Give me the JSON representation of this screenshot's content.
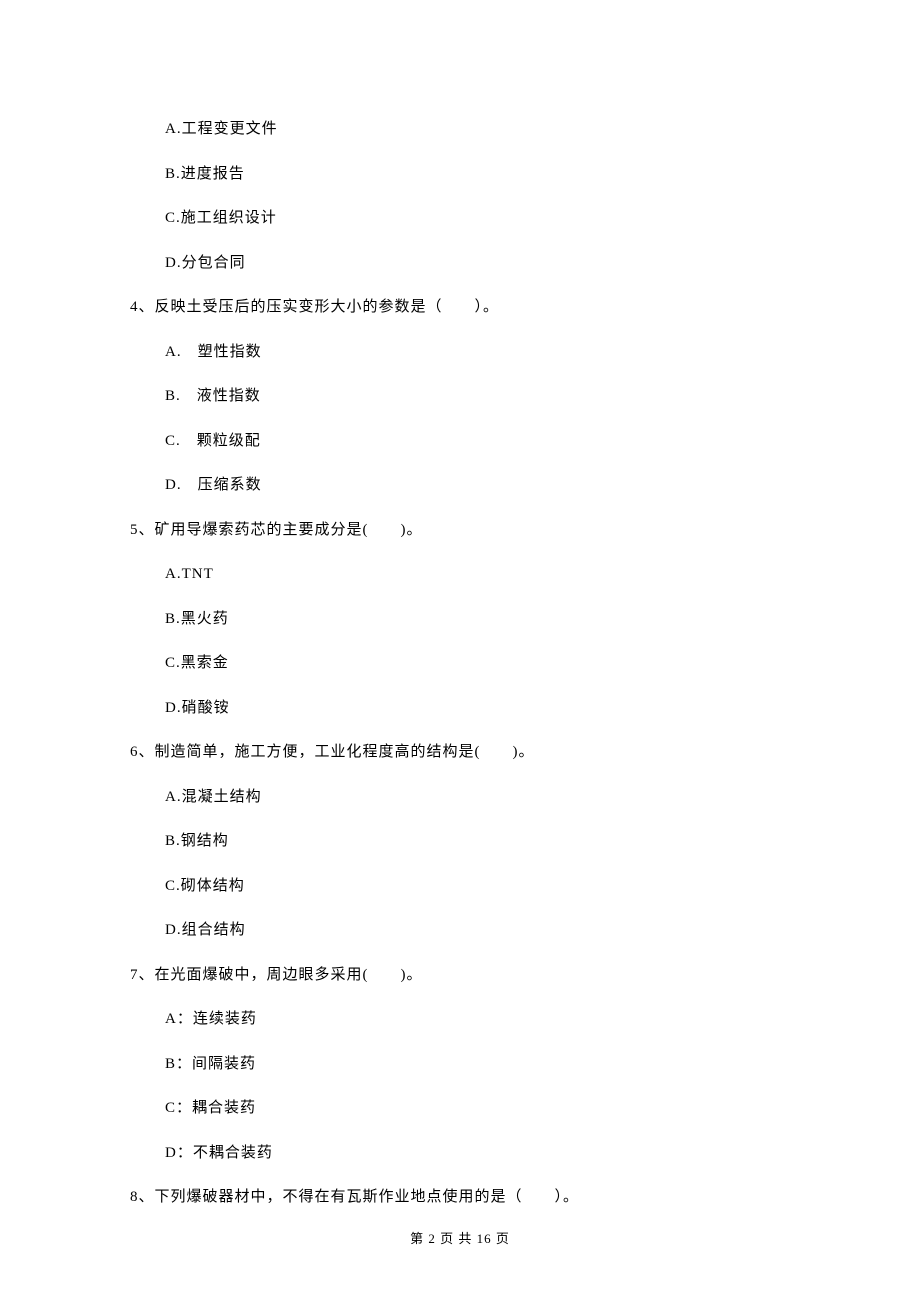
{
  "q3": {
    "optA": "A.工程变更文件",
    "optB": "B.进度报告",
    "optC": "C.施工组织设计",
    "optD": "D.分包合同"
  },
  "q4": {
    "stem": "4、反映土受压后的压实变形大小的参数是（　　）。",
    "optA": "A.　塑性指数",
    "optB": "B.　液性指数",
    "optC": "C.　颗粒级配",
    "optD": "D.　压缩系数"
  },
  "q5": {
    "stem": "5、矿用导爆索药芯的主要成分是(　　)。",
    "optA": "A.TNT",
    "optB": "B.黑火药",
    "optC": "C.黑索金",
    "optD": "D.硝酸铵"
  },
  "q6": {
    "stem": "6、制造简单，施工方便，工业化程度高的结构是(　　)。",
    "optA": "A.混凝土结构",
    "optB": "B.钢结构",
    "optC": "C.砌体结构",
    "optD": "D.组合结构"
  },
  "q7": {
    "stem": "7、在光面爆破中，周边眼多采用(　　)。",
    "optA": "A：连续装药",
    "optB": "B：间隔装药",
    "optC": "C：耦合装药",
    "optD": "D：不耦合装药"
  },
  "q8": {
    "stem": "8、下列爆破器材中，不得在有瓦斯作业地点使用的是（　　）。"
  },
  "footer": "第 2 页 共 16 页"
}
